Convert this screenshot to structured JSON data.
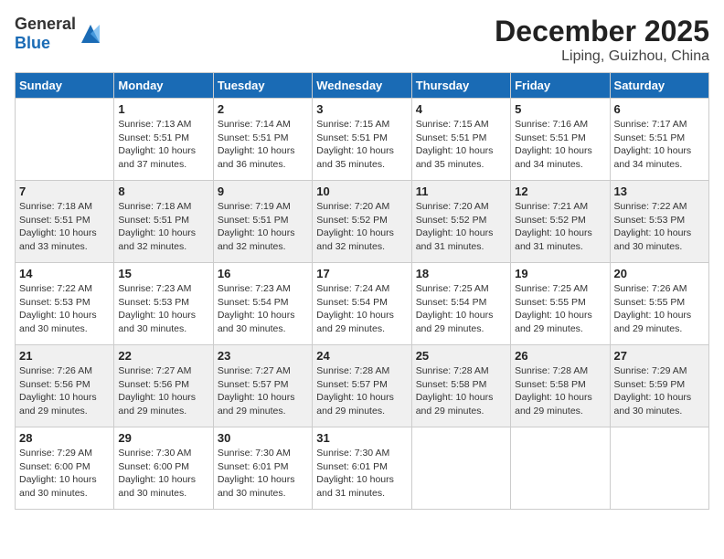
{
  "header": {
    "logo_general": "General",
    "logo_blue": "Blue",
    "month": "December 2025",
    "location": "Liping, Guizhou, China"
  },
  "days_of_week": [
    "Sunday",
    "Monday",
    "Tuesday",
    "Wednesday",
    "Thursday",
    "Friday",
    "Saturday"
  ],
  "weeks": [
    [
      null,
      {
        "num": "1",
        "sunrise": "7:13 AM",
        "sunset": "5:51 PM",
        "daylight": "10 hours and 37 minutes."
      },
      {
        "num": "2",
        "sunrise": "7:14 AM",
        "sunset": "5:51 PM",
        "daylight": "10 hours and 36 minutes."
      },
      {
        "num": "3",
        "sunrise": "7:15 AM",
        "sunset": "5:51 PM",
        "daylight": "10 hours and 35 minutes."
      },
      {
        "num": "4",
        "sunrise": "7:15 AM",
        "sunset": "5:51 PM",
        "daylight": "10 hours and 35 minutes."
      },
      {
        "num": "5",
        "sunrise": "7:16 AM",
        "sunset": "5:51 PM",
        "daylight": "10 hours and 34 minutes."
      },
      {
        "num": "6",
        "sunrise": "7:17 AM",
        "sunset": "5:51 PM",
        "daylight": "10 hours and 34 minutes."
      }
    ],
    [
      {
        "num": "7",
        "sunrise": "7:18 AM",
        "sunset": "5:51 PM",
        "daylight": "10 hours and 33 minutes."
      },
      {
        "num": "8",
        "sunrise": "7:18 AM",
        "sunset": "5:51 PM",
        "daylight": "10 hours and 32 minutes."
      },
      {
        "num": "9",
        "sunrise": "7:19 AM",
        "sunset": "5:51 PM",
        "daylight": "10 hours and 32 minutes."
      },
      {
        "num": "10",
        "sunrise": "7:20 AM",
        "sunset": "5:52 PM",
        "daylight": "10 hours and 32 minutes."
      },
      {
        "num": "11",
        "sunrise": "7:20 AM",
        "sunset": "5:52 PM",
        "daylight": "10 hours and 31 minutes."
      },
      {
        "num": "12",
        "sunrise": "7:21 AM",
        "sunset": "5:52 PM",
        "daylight": "10 hours and 31 minutes."
      },
      {
        "num": "13",
        "sunrise": "7:22 AM",
        "sunset": "5:53 PM",
        "daylight": "10 hours and 30 minutes."
      }
    ],
    [
      {
        "num": "14",
        "sunrise": "7:22 AM",
        "sunset": "5:53 PM",
        "daylight": "10 hours and 30 minutes."
      },
      {
        "num": "15",
        "sunrise": "7:23 AM",
        "sunset": "5:53 PM",
        "daylight": "10 hours and 30 minutes."
      },
      {
        "num": "16",
        "sunrise": "7:23 AM",
        "sunset": "5:54 PM",
        "daylight": "10 hours and 30 minutes."
      },
      {
        "num": "17",
        "sunrise": "7:24 AM",
        "sunset": "5:54 PM",
        "daylight": "10 hours and 29 minutes."
      },
      {
        "num": "18",
        "sunrise": "7:25 AM",
        "sunset": "5:54 PM",
        "daylight": "10 hours and 29 minutes."
      },
      {
        "num": "19",
        "sunrise": "7:25 AM",
        "sunset": "5:55 PM",
        "daylight": "10 hours and 29 minutes."
      },
      {
        "num": "20",
        "sunrise": "7:26 AM",
        "sunset": "5:55 PM",
        "daylight": "10 hours and 29 minutes."
      }
    ],
    [
      {
        "num": "21",
        "sunrise": "7:26 AM",
        "sunset": "5:56 PM",
        "daylight": "10 hours and 29 minutes."
      },
      {
        "num": "22",
        "sunrise": "7:27 AM",
        "sunset": "5:56 PM",
        "daylight": "10 hours and 29 minutes."
      },
      {
        "num": "23",
        "sunrise": "7:27 AM",
        "sunset": "5:57 PM",
        "daylight": "10 hours and 29 minutes."
      },
      {
        "num": "24",
        "sunrise": "7:28 AM",
        "sunset": "5:57 PM",
        "daylight": "10 hours and 29 minutes."
      },
      {
        "num": "25",
        "sunrise": "7:28 AM",
        "sunset": "5:58 PM",
        "daylight": "10 hours and 29 minutes."
      },
      {
        "num": "26",
        "sunrise": "7:28 AM",
        "sunset": "5:58 PM",
        "daylight": "10 hours and 29 minutes."
      },
      {
        "num": "27",
        "sunrise": "7:29 AM",
        "sunset": "5:59 PM",
        "daylight": "10 hours and 30 minutes."
      }
    ],
    [
      {
        "num": "28",
        "sunrise": "7:29 AM",
        "sunset": "6:00 PM",
        "daylight": "10 hours and 30 minutes."
      },
      {
        "num": "29",
        "sunrise": "7:30 AM",
        "sunset": "6:00 PM",
        "daylight": "10 hours and 30 minutes."
      },
      {
        "num": "30",
        "sunrise": "7:30 AM",
        "sunset": "6:01 PM",
        "daylight": "10 hours and 30 minutes."
      },
      {
        "num": "31",
        "sunrise": "7:30 AM",
        "sunset": "6:01 PM",
        "daylight": "10 hours and 31 minutes."
      },
      null,
      null,
      null
    ]
  ]
}
